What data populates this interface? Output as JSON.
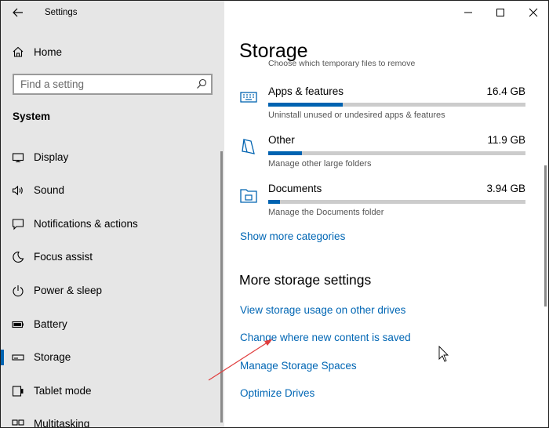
{
  "window": {
    "app_title": "Settings",
    "controls": {
      "minimize": "minimize-icon",
      "maximize": "maximize-icon",
      "close": "close-icon"
    }
  },
  "sidebar": {
    "home_label": "Home",
    "search_placeholder": "Find a setting",
    "section_label": "System",
    "items": [
      {
        "label": "Display",
        "icon": "display-icon"
      },
      {
        "label": "Sound",
        "icon": "sound-icon"
      },
      {
        "label": "Notifications & actions",
        "icon": "notifications-icon"
      },
      {
        "label": "Focus assist",
        "icon": "focus-assist-icon"
      },
      {
        "label": "Power & sleep",
        "icon": "power-icon"
      },
      {
        "label": "Battery",
        "icon": "battery-icon"
      },
      {
        "label": "Storage",
        "icon": "storage-icon",
        "selected": true
      },
      {
        "label": "Tablet mode",
        "icon": "tablet-mode-icon"
      },
      {
        "label": "Multitasking",
        "icon": "multitasking-icon"
      }
    ]
  },
  "main": {
    "title": "Storage",
    "clipped_text": "Choose which temporary files to remove",
    "categories": [
      {
        "name": "Apps & features",
        "size": "16.4 GB",
        "description": "Uninstall unused or undesired apps & features",
        "fill_fraction": 0.29,
        "icon": "apps-features-icon"
      },
      {
        "name": "Other",
        "size": "11.9 GB",
        "description": "Manage other large folders",
        "fill_fraction": 0.13,
        "icon": "other-icon"
      },
      {
        "name": "Documents",
        "size": "3.94 GB",
        "description": "Manage the Documents folder",
        "fill_fraction": 0.045,
        "icon": "documents-icon"
      }
    ],
    "show_more_label": "Show more categories",
    "more_settings_heading": "More storage settings",
    "links": [
      "View storage usage on other drives",
      "Change where new content is saved",
      "Manage Storage Spaces",
      "Optimize Drives"
    ]
  },
  "colors": {
    "accent": "#0063b1",
    "link": "#0066b4",
    "sidebar_bg": "#e6e6e6",
    "annotation_arrow": "#e03c3c"
  }
}
